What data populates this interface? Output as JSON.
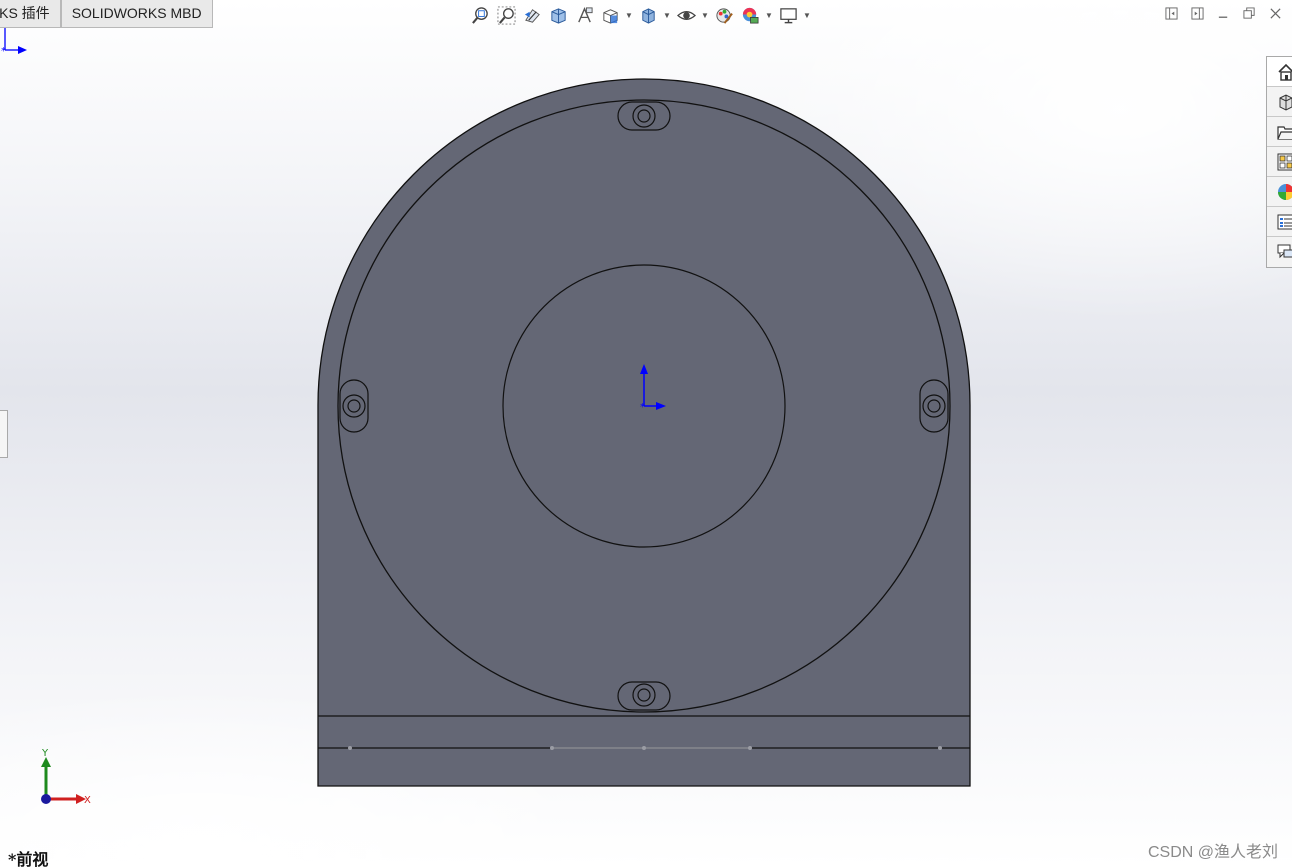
{
  "command_manager": {
    "tabs": [
      {
        "label": "RKS 插件"
      },
      {
        "label": "SOLIDWORKS MBD"
      }
    ]
  },
  "heads_up_toolbar": {
    "icons": [
      "zoom-to-fit-icon",
      "zoom-to-area-icon",
      "previous-view-icon",
      "section-view-icon",
      "dynamic-annotation-views-icon",
      "view-orientation-icon",
      "display-style-icon",
      "hide-show-items-icon",
      "edit-appearance-icon",
      "apply-scene-icon",
      "view-settings-icon"
    ]
  },
  "window_controls": [
    "tile-left-icon",
    "tile-right-icon",
    "minimize-icon",
    "restore-icon",
    "close-icon"
  ],
  "task_pane": {
    "items": [
      "solidworks-resources-icon",
      "design-library-icon",
      "file-explorer-icon",
      "view-palette-icon",
      "appearances-scenes-icon",
      "custom-properties-icon",
      "solidworks-forum-icon"
    ]
  },
  "viewport": {
    "view_name": "*前视",
    "triad": {
      "x_label": "X",
      "y_label": "Y"
    },
    "part_color": "#646775"
  },
  "watermark": "CSDN @渔人老刘"
}
